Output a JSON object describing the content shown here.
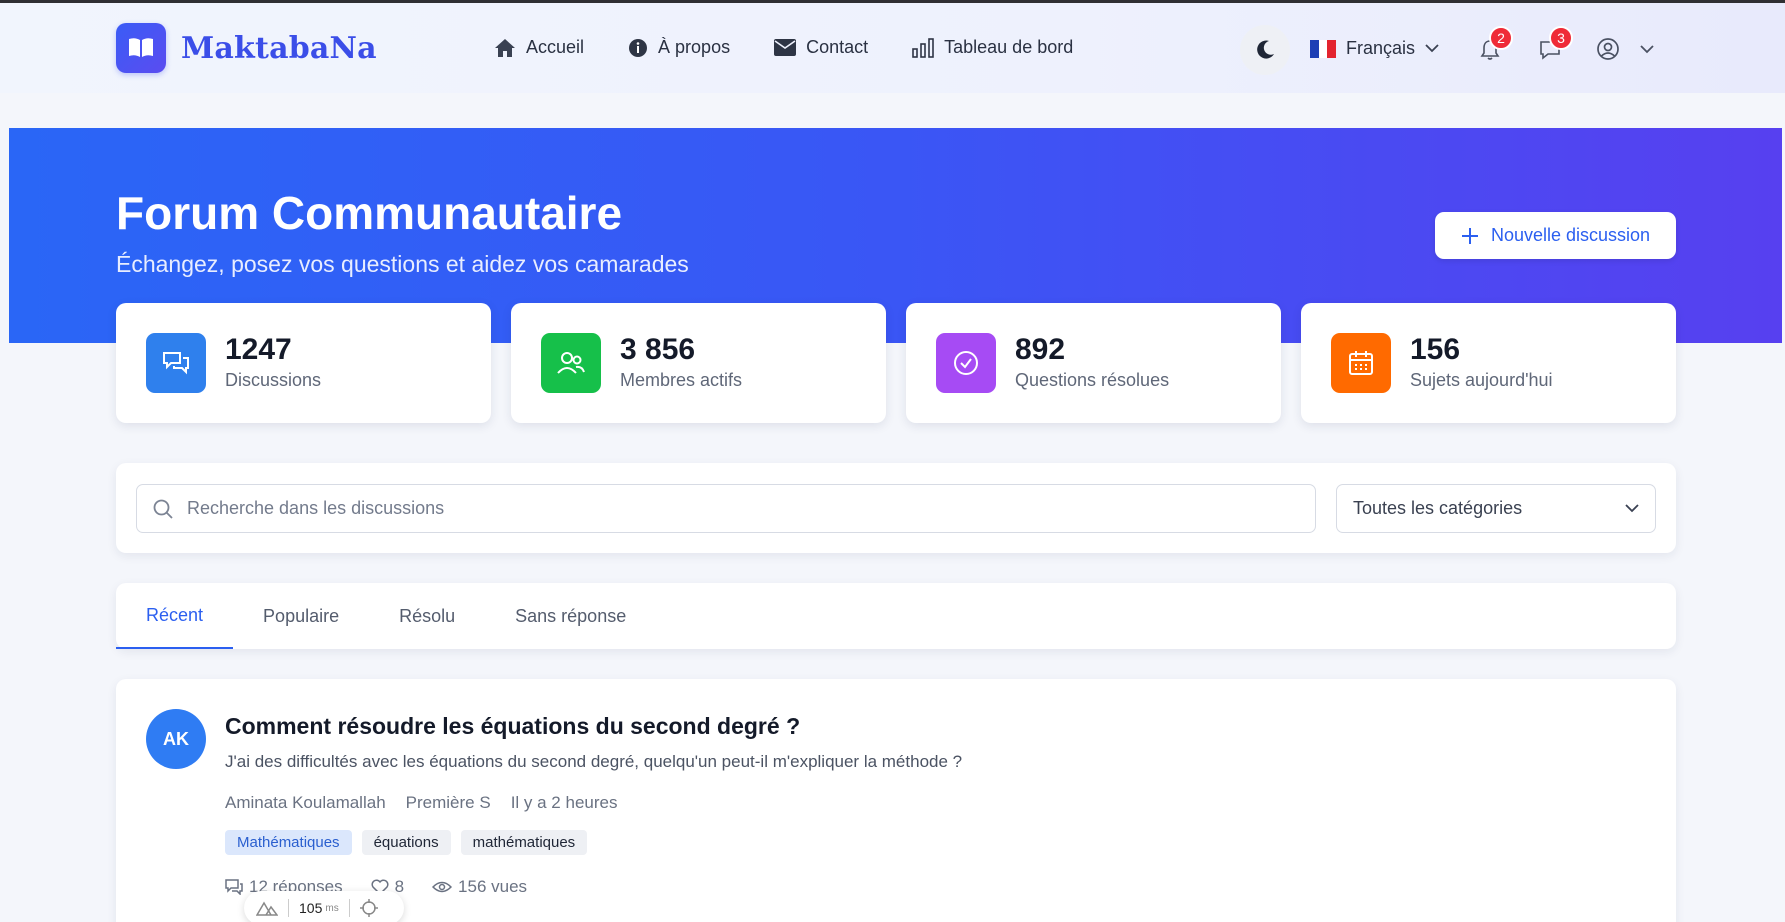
{
  "brand": {
    "name": "MaktabaNa"
  },
  "nav": {
    "links": [
      {
        "label": "Accueil",
        "icon": "home-icon"
      },
      {
        "label": "À propos",
        "icon": "info-icon"
      },
      {
        "label": "Contact",
        "icon": "mail-icon"
      },
      {
        "label": "Tableau de bord",
        "icon": "chart-icon"
      }
    ],
    "language": "Français",
    "notifications_count": "2",
    "messages_count": "3"
  },
  "hero": {
    "title": "Forum Communautaire",
    "subtitle": "Échangez, posez vos questions et aidez vos camarades",
    "new_button": "Nouvelle discussion"
  },
  "stats": [
    {
      "value": "1247",
      "label": "Discussions",
      "color": "#2f80ed"
    },
    {
      "value": "3 856",
      "label": "Membres actifs",
      "color": "#16c04a"
    },
    {
      "value": "892",
      "label": "Questions résolues",
      "color": "#a64bf4"
    },
    {
      "value": "156",
      "label": "Sujets aujourd'hui",
      "color": "#ff6a00"
    }
  ],
  "search": {
    "placeholder": "Recherche dans les discussions",
    "category": "Toutes les catégories"
  },
  "tabs": [
    {
      "label": "Récent"
    },
    {
      "label": "Populaire"
    },
    {
      "label": "Résolu"
    },
    {
      "label": "Sans réponse"
    }
  ],
  "post": {
    "initials": "AK",
    "title": "Comment résoudre les équations du second degré ?",
    "excerpt": "J'ai des difficultés avec les équations du second degré, quelqu'un peut-il m'expliquer la méthode ?",
    "author": "Aminata Koulamallah",
    "class": "Première S",
    "time": "Il y a 2 heures",
    "tags": [
      "Mathématiques",
      "équations",
      "mathématiques"
    ],
    "replies": "12 réponses",
    "likes": "8",
    "views": "156 vues"
  },
  "devbar": {
    "value": "105",
    "unit": "ms"
  }
}
